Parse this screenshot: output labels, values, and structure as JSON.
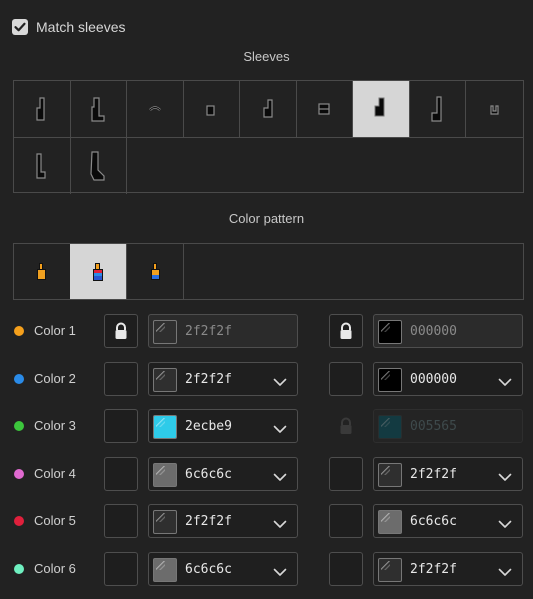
{
  "match_sleeves": {
    "label": "Match sleeves",
    "checked": true
  },
  "sleeves": {
    "title": "Sleeves",
    "styles": [
      "sleeve-style-1",
      "sleeve-style-2",
      "sleeve-style-3",
      "sleeve-style-4",
      "sleeve-style-5",
      "sleeve-style-6",
      "sleeve-style-7",
      "sleeve-style-8",
      "sleeve-style-9",
      "sleeve-style-10",
      "sleeve-style-11"
    ],
    "selected_index": 6
  },
  "color_pattern": {
    "title": "Color pattern",
    "patterns": [
      "pattern-orange",
      "pattern-multicolor",
      "pattern-blue-orange"
    ],
    "selected_index": 1
  },
  "color_rows": [
    {
      "label": "Color 1",
      "dot": "#f5a01c",
      "left": {
        "locked": true,
        "lock_state": "locked",
        "hex": "2f2f2f",
        "swatch": "#2f2f2f",
        "dropdown": false
      },
      "right": {
        "locked": true,
        "lock_state": "locked",
        "hex": "000000",
        "swatch": "#000000",
        "dropdown": false
      }
    },
    {
      "label": "Color 2",
      "dot": "#2a8be8",
      "left": {
        "locked": false,
        "hex": "2f2f2f",
        "swatch": "#2f2f2f",
        "dropdown": true
      },
      "right": {
        "locked": false,
        "hex": "000000",
        "swatch": "#000000",
        "dropdown": true
      }
    },
    {
      "label": "Color 3",
      "dot": "#3cc63c",
      "left": {
        "locked": false,
        "hex": "2ecbe9",
        "swatch": "#2ecbe9",
        "dropdown": true
      },
      "right": {
        "locked": false,
        "disabled": true,
        "lock_state": "disabled",
        "hex": "005565",
        "swatch": "#005565",
        "dropdown": false
      }
    },
    {
      "label": "Color 4",
      "dot": "#e06ad0",
      "left": {
        "locked": false,
        "hex": "6c6c6c",
        "swatch": "#6c6c6c",
        "dropdown": true
      },
      "right": {
        "locked": false,
        "hex": "2f2f2f",
        "swatch": "#2f2f2f",
        "dropdown": true
      }
    },
    {
      "label": "Color 5",
      "dot": "#e0203c",
      "left": {
        "locked": false,
        "hex": "2f2f2f",
        "swatch": "#2f2f2f",
        "dropdown": true
      },
      "right": {
        "locked": false,
        "hex": "6c6c6c",
        "swatch": "#6c6c6c",
        "dropdown": true
      }
    },
    {
      "label": "Color 6",
      "dot": "#6ff0c0",
      "left": {
        "locked": false,
        "hex": "6c6c6c",
        "swatch": "#6c6c6c",
        "dropdown": true
      },
      "right": {
        "locked": false,
        "hex": "2f2f2f",
        "swatch": "#2f2f2f",
        "dropdown": true
      }
    }
  ]
}
